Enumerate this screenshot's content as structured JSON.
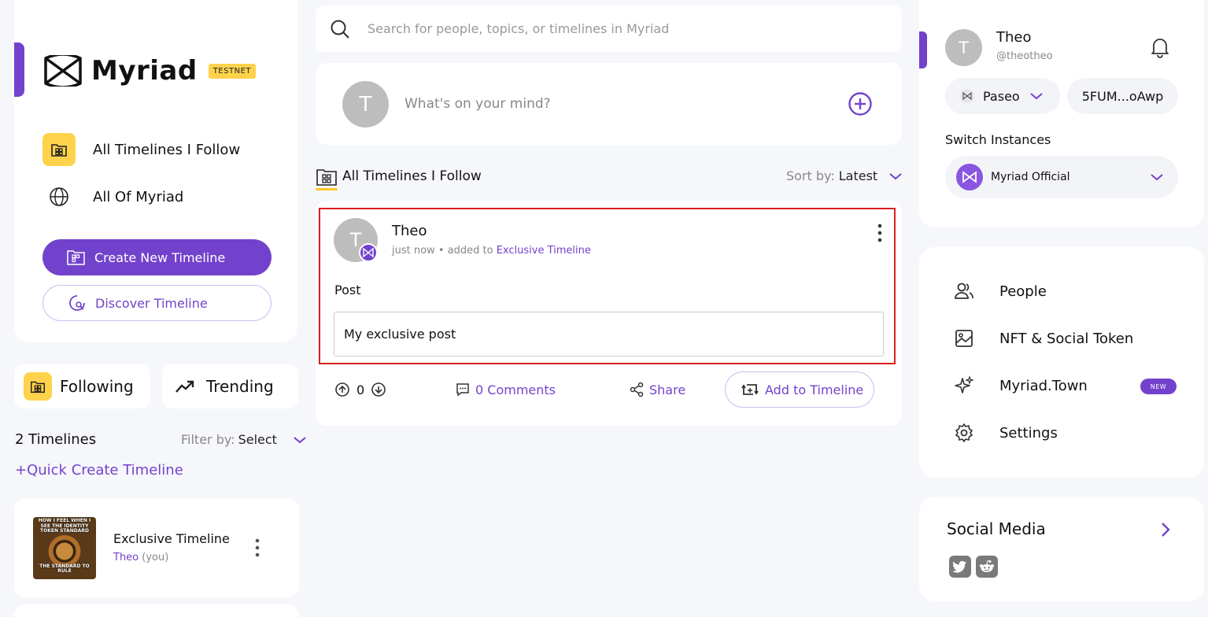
{
  "brand": {
    "name": "Myriad",
    "badge": "TESTNET"
  },
  "left_nav": {
    "items": [
      {
        "label": "All Timelines I Follow",
        "icon": "timeline-grid-icon"
      },
      {
        "label": "All Of Myriad",
        "icon": "globe-icon"
      }
    ],
    "create_button": "Create New Timeline",
    "discover_button": "Discover Timeline"
  },
  "tabs": {
    "following": "Following",
    "trending": "Trending"
  },
  "timelines_section": {
    "count_label": "2 Timelines",
    "filter_label": "Filter by:",
    "filter_value": "Select",
    "quick_create": "+Quick Create Timeline",
    "items": [
      {
        "name": "Exclusive Timeline",
        "owner": "Theo",
        "owner_suffix": "(you)",
        "thumb_top": "HOW I FEEL WHEN I SEE THE IDENTITY TOKEN STANDARD",
        "thumb_bottom": "THE STANDARD TO RULE"
      }
    ]
  },
  "search": {
    "placeholder": "Search for people, topics, or timelines in Myriad"
  },
  "composer": {
    "avatar_letter": "T",
    "placeholder": "What's on your mind?"
  },
  "feed": {
    "title": "All Timelines I Follow",
    "sort_label": "Sort by:",
    "sort_value": "Latest"
  },
  "post": {
    "avatar_letter": "T",
    "author": "Theo",
    "time": "just now",
    "meta_text": "• added to",
    "timeline": "Exclusive Timeline",
    "type_label": "Post",
    "body": "My exclusive post",
    "votes": "0",
    "comments": "0 Comments",
    "share": "Share",
    "add_to_timeline": "Add to Timeline"
  },
  "profile": {
    "avatar_letter": "T",
    "name": "Theo",
    "handle": "@theotheo",
    "network": "Paseo",
    "wallet": "5FUM...oAwp",
    "switch_label": "Switch Instances",
    "instance": "Myriad Official"
  },
  "right_menu": {
    "items": [
      {
        "label": "People",
        "icon": "people-icon"
      },
      {
        "label": "NFT & Social Token",
        "icon": "image-icon"
      },
      {
        "label": "Myriad.Town",
        "icon": "sparkle-icon",
        "badge": "NEW"
      },
      {
        "label": "Settings",
        "icon": "gear-icon"
      }
    ]
  },
  "social": {
    "title": "Social Media",
    "icons": [
      "twitter-icon",
      "reddit-icon"
    ]
  },
  "colors": {
    "accent": "#7342cc",
    "yellow": "#ffd24c",
    "highlight": "#d91e1e",
    "background": "#f6f7fb"
  }
}
